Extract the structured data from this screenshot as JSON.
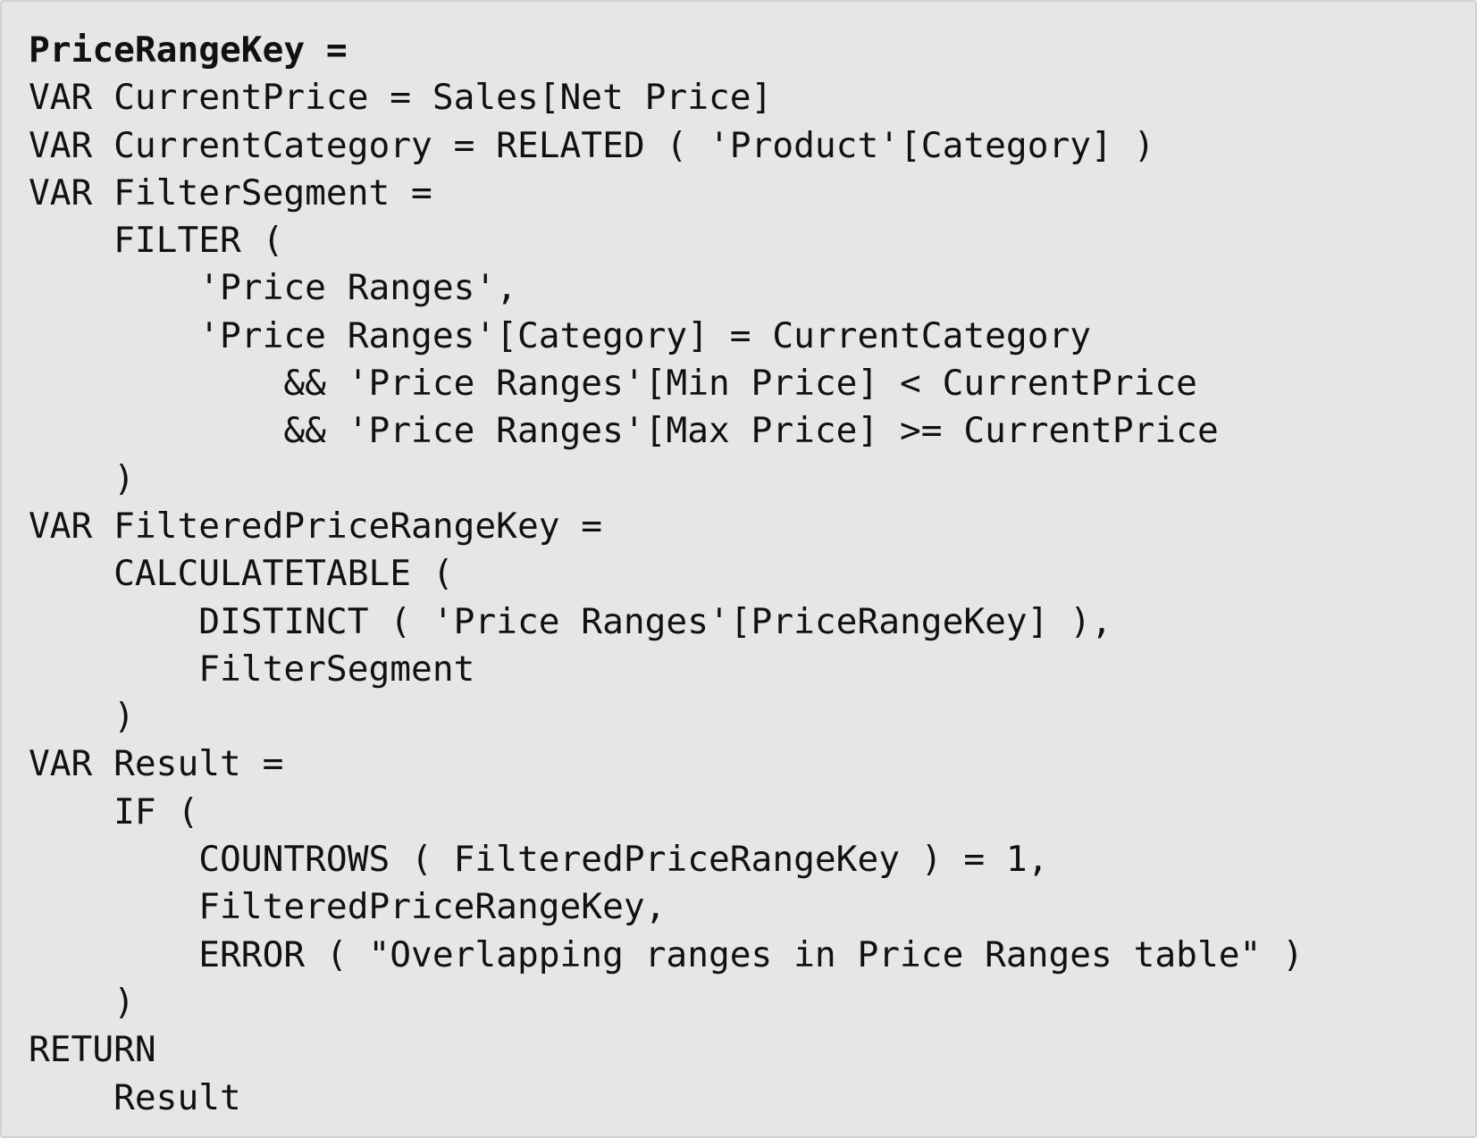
{
  "code": {
    "lines": [
      "PriceRangeKey =",
      "VAR CurrentPrice = Sales[Net Price]",
      "VAR CurrentCategory = RELATED ( 'Product'[Category] )",
      "VAR FilterSegment =",
      "    FILTER (",
      "        'Price Ranges',",
      "        'Price Ranges'[Category] = CurrentCategory",
      "            && 'Price Ranges'[Min Price] < CurrentPrice",
      "            && 'Price Ranges'[Max Price] >= CurrentPrice",
      "    )",
      "VAR FilteredPriceRangeKey =",
      "    CALCULATETABLE (",
      "        DISTINCT ( 'Price Ranges'[PriceRangeKey] ),",
      "        FilterSegment",
      "    )",
      "VAR Result =",
      "    IF (",
      "        COUNTROWS ( FilteredPriceRangeKey ) = 1,",
      "        FilteredPriceRangeKey,",
      "        ERROR ( \"Overlapping ranges in Price Ranges table\" )",
      "    )",
      "RETURN",
      "    Result"
    ]
  }
}
